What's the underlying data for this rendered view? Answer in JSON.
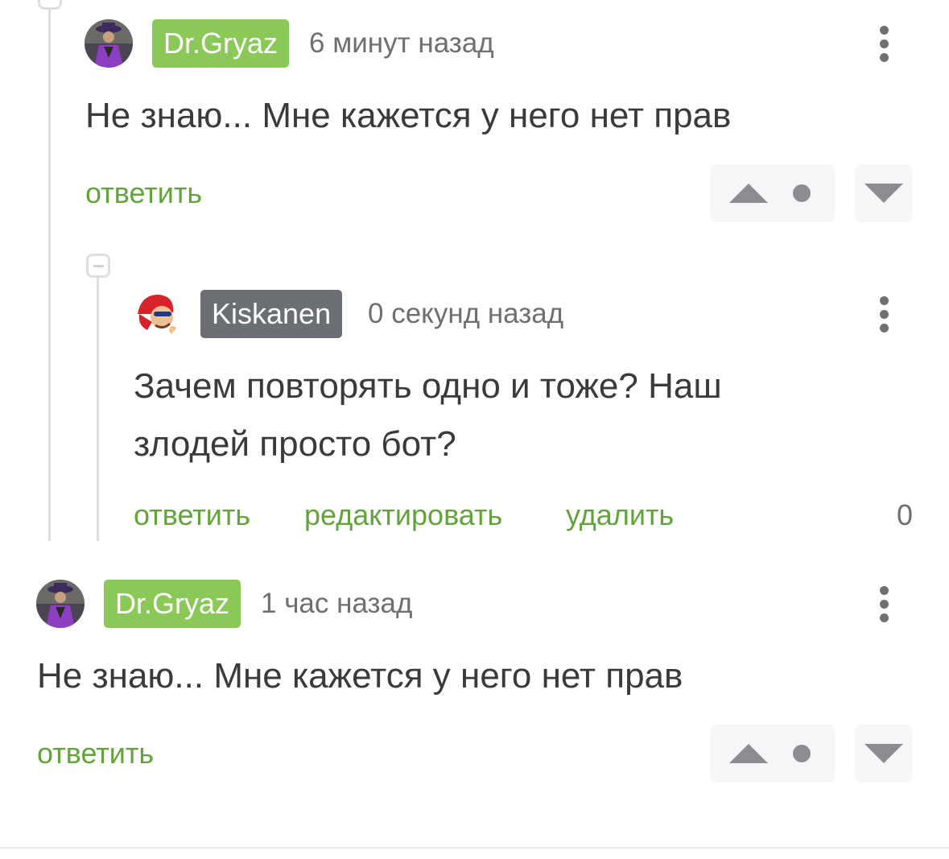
{
  "comments": [
    {
      "author": "Dr.Gryaz",
      "time": "6 минут назад",
      "text": "Не знаю... Мне кажется у него нет прав",
      "reply_label": "ответить"
    },
    {
      "author": "Kiskanen",
      "time": "0 секунд назад",
      "text_lines": [
        "Зачем повторять одно и тоже? Наш",
        "злодей просто бот?"
      ],
      "reply_label": "ответить",
      "edit_label": "редактировать",
      "delete_label": "удалить",
      "rating": "0"
    },
    {
      "author": "Dr.Gryaz",
      "time": "1 час назад",
      "text": "Не знаю... Мне кажется у него нет прав",
      "reply_label": "ответить"
    }
  ],
  "icons": {
    "menu": "kebab-menu-icon",
    "upvote": "triangle-up-icon",
    "downvote": "triangle-down-icon",
    "collapse": "minus-icon"
  },
  "colors": {
    "accent_green": "#62a33b",
    "badge_green": "#8ac858",
    "badge_gray": "#6b6f73",
    "thread_line": "#dedede"
  }
}
